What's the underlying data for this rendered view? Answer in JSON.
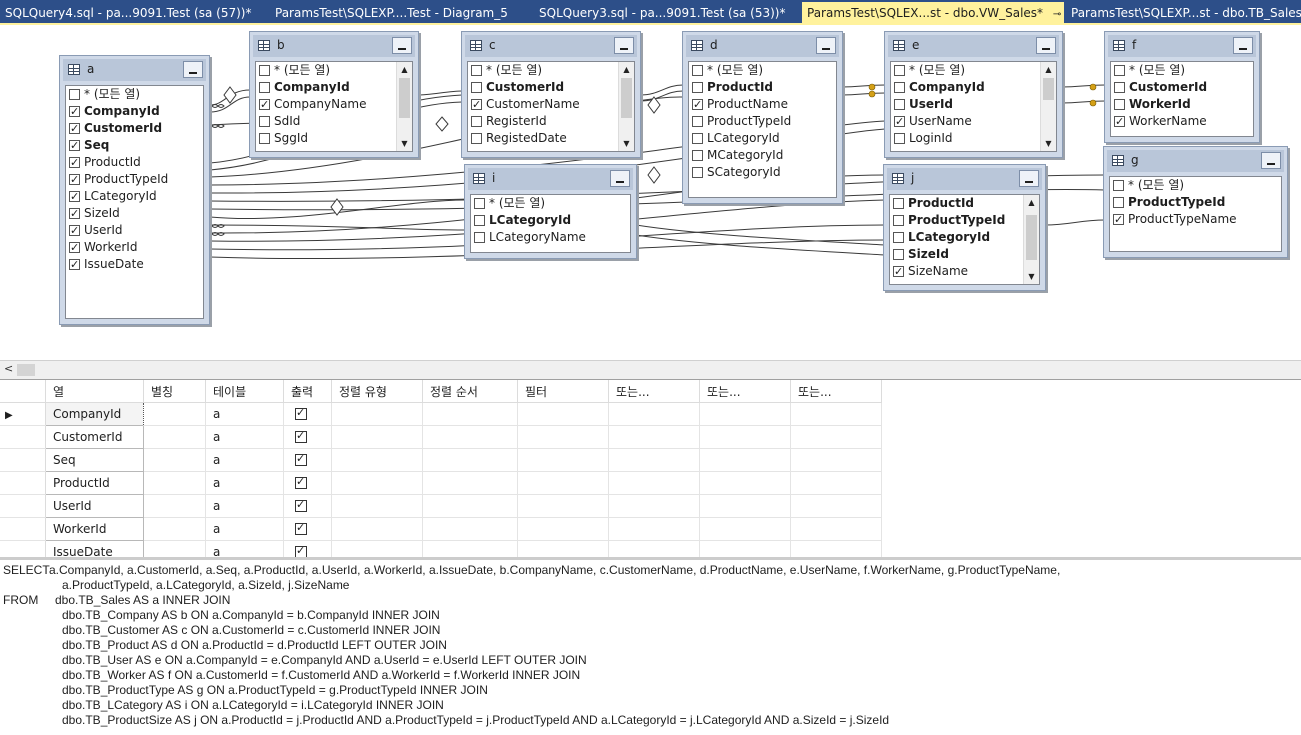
{
  "tabs": [
    {
      "label": "SQLQuery4.sql - pa...9091.Test (sa (57))*",
      "active": false
    },
    {
      "label": "ParamsTest\\SQLEXP....Test - Diagram_5",
      "active": false
    },
    {
      "label": "SQLQuery3.sql - pa...9091.Test (sa (53))*",
      "active": false
    },
    {
      "label": "ParamsTest\\SQLEX...st - dbo.VW_Sales*",
      "active": true
    },
    {
      "label": "ParamsTest\\SQLEXP...st - dbo.TB_Sales",
      "active": false
    }
  ],
  "tables": {
    "a": {
      "name": "a",
      "rows": [
        {
          "label": "* (모든 열)",
          "checked": false,
          "bold": false
        },
        {
          "label": "CompanyId",
          "checked": true,
          "bold": true
        },
        {
          "label": "CustomerId",
          "checked": true,
          "bold": true
        },
        {
          "label": "Seq",
          "checked": true,
          "bold": true
        },
        {
          "label": "ProductId",
          "checked": true,
          "bold": false
        },
        {
          "label": "ProductTypeId",
          "checked": true,
          "bold": false
        },
        {
          "label": "LCategoryId",
          "checked": true,
          "bold": false
        },
        {
          "label": "SizeId",
          "checked": true,
          "bold": false
        },
        {
          "label": "UserId",
          "checked": true,
          "bold": false
        },
        {
          "label": "WorkerId",
          "checked": true,
          "bold": false
        },
        {
          "label": "IssueDate",
          "checked": true,
          "bold": false
        }
      ]
    },
    "b": {
      "name": "b",
      "rows": [
        {
          "label": "* (모든 열)",
          "checked": false,
          "bold": false
        },
        {
          "label": "CompanyId",
          "checked": false,
          "bold": true
        },
        {
          "label": "CompanyName",
          "checked": true,
          "bold": false
        },
        {
          "label": "SdId",
          "checked": false,
          "bold": false
        },
        {
          "label": "SggId",
          "checked": false,
          "bold": false
        }
      ]
    },
    "c": {
      "name": "c",
      "rows": [
        {
          "label": "* (모든 열)",
          "checked": false,
          "bold": false
        },
        {
          "label": "CustomerId",
          "checked": false,
          "bold": true
        },
        {
          "label": "CustomerName",
          "checked": true,
          "bold": false
        },
        {
          "label": "RegisterId",
          "checked": false,
          "bold": false
        },
        {
          "label": "RegistedDate",
          "checked": false,
          "bold": false
        }
      ]
    },
    "d": {
      "name": "d",
      "rows": [
        {
          "label": "* (모든 열)",
          "checked": false,
          "bold": false
        },
        {
          "label": "ProductId",
          "checked": false,
          "bold": true
        },
        {
          "label": "ProductName",
          "checked": true,
          "bold": false
        },
        {
          "label": "ProductTypeId",
          "checked": false,
          "bold": false
        },
        {
          "label": "LCategoryId",
          "checked": false,
          "bold": false
        },
        {
          "label": "MCategoryId",
          "checked": false,
          "bold": false
        },
        {
          "label": "SCategoryId",
          "checked": false,
          "bold": false
        }
      ]
    },
    "e": {
      "name": "e",
      "rows": [
        {
          "label": "* (모든 열)",
          "checked": false,
          "bold": false
        },
        {
          "label": "CompanyId",
          "checked": false,
          "bold": true
        },
        {
          "label": "UserId",
          "checked": false,
          "bold": true
        },
        {
          "label": "UserName",
          "checked": true,
          "bold": false
        },
        {
          "label": "LoginId",
          "checked": false,
          "bold": false
        }
      ]
    },
    "f": {
      "name": "f",
      "rows": [
        {
          "label": "* (모든 열)",
          "checked": false,
          "bold": false
        },
        {
          "label": "CustomerId",
          "checked": false,
          "bold": true
        },
        {
          "label": "WorkerId",
          "checked": false,
          "bold": true
        },
        {
          "label": "WorkerName",
          "checked": true,
          "bold": false
        }
      ]
    },
    "g": {
      "name": "g",
      "rows": [
        {
          "label": "* (모든 열)",
          "checked": false,
          "bold": false
        },
        {
          "label": "ProductTypeId",
          "checked": false,
          "bold": true
        },
        {
          "label": "ProductTypeName",
          "checked": true,
          "bold": false
        }
      ]
    },
    "i": {
      "name": "i",
      "rows": [
        {
          "label": "* (모든 열)",
          "checked": false,
          "bold": false
        },
        {
          "label": "LCategoryId",
          "checked": false,
          "bold": true
        },
        {
          "label": "LCategoryName",
          "checked": false,
          "bold": false
        }
      ]
    },
    "j": {
      "name": "j",
      "rows": [
        {
          "label": "ProductId",
          "checked": false,
          "bold": true
        },
        {
          "label": "ProductTypeId",
          "checked": false,
          "bold": true
        },
        {
          "label": "LCategoryId",
          "checked": false,
          "bold": true
        },
        {
          "label": "SizeId",
          "checked": false,
          "bold": true
        },
        {
          "label": "SizeName",
          "checked": true,
          "bold": false
        }
      ]
    }
  },
  "grid": {
    "headers": [
      "열",
      "별칭",
      "테이블",
      "출력",
      "정렬 유형",
      "정렬 순서",
      "필터",
      "또는...",
      "또는...",
      "또는..."
    ],
    "rows": [
      {
        "column": "CompanyId",
        "table": "a",
        "output": true
      },
      {
        "column": "CustomerId",
        "table": "a",
        "output": true
      },
      {
        "column": "Seq",
        "table": "a",
        "output": true
      },
      {
        "column": "ProductId",
        "table": "a",
        "output": true
      },
      {
        "column": "UserId",
        "table": "a",
        "output": true
      },
      {
        "column": "WorkerId",
        "table": "a",
        "output": true
      },
      {
        "column": "IssueDate",
        "table": "a",
        "output": true
      }
    ]
  },
  "sql": {
    "lines": [
      {
        "kw": "SELECT",
        "text": "a.CompanyId, a.CustomerId, a.Seq, a.ProductId, a.UserId, a.WorkerId, a.IssueDate, b.CompanyName, c.CustomerName, d.ProductName, e.UserName, f.WorkerName, g.ProductTypeName,"
      },
      {
        "kw": "",
        "text": "a.ProductTypeId, a.LCategoryId, a.SizeId, j.SizeName"
      },
      {
        "kw": "FROM",
        "text": "dbo.TB_Sales AS a INNER JOIN"
      },
      {
        "kw": "",
        "text": "dbo.TB_Company AS b ON a.CompanyId = b.CompanyId INNER JOIN"
      },
      {
        "kw": "",
        "text": "dbo.TB_Customer AS c ON a.CustomerId = c.CustomerId INNER JOIN"
      },
      {
        "kw": "",
        "text": "dbo.TB_Product AS d ON a.ProductId = d.ProductId LEFT OUTER JOIN"
      },
      {
        "kw": "",
        "text": "dbo.TB_User AS e ON a.CompanyId = e.CompanyId AND a.UserId = e.UserId LEFT OUTER JOIN"
      },
      {
        "kw": "",
        "text": "dbo.TB_Worker AS f ON a.CustomerId = f.CustomerId AND a.WorkerId = f.WorkerId INNER JOIN"
      },
      {
        "kw": "",
        "text": "dbo.TB_ProductType AS g ON a.ProductTypeId = g.ProductTypeId INNER JOIN"
      },
      {
        "kw": "",
        "text": "dbo.TB_LCategory AS i ON a.LCategoryId = i.LCategoryId INNER JOIN"
      },
      {
        "kw": "",
        "text": "dbo.TB_ProductSize AS j ON a.ProductId = j.ProductId AND a.ProductTypeId = j.ProductTypeId AND a.LCategoryId = j.LCategoryId AND a.SizeId = j.SizeId"
      }
    ]
  },
  "colors": {
    "tabbar": "#2d4f89",
    "active_tab": "#fff29d",
    "table_frame": "#cfd9e8"
  },
  "icons": {
    "table": "table-grid-icon",
    "minimize": "minimize-icon",
    "row_pointer": "row-pointer-icon",
    "key": "key-icon"
  }
}
